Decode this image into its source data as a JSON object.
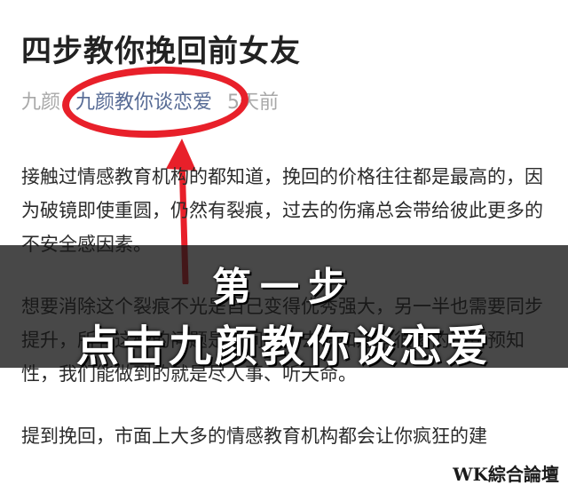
{
  "article": {
    "title": "四步教你挽回前女友",
    "meta": {
      "author": "九颜",
      "account": "九颜教你谈恋爱",
      "time": "5天前"
    },
    "paragraphs": [
      "接触过情感教育机构的都知道，挽回的价格往往都是最高的，因为破镜即使重圆，仍然有裂痕，过去的伤痛总会带给彼此更多的不安全感因素。",
      "想要消除这个裂痕不光是自己变得优秀强大，另一半也需要同步提升，所有这些的问题是时间的力去调和还有很多的不可预知性，我们能做到的就是尽人事、听天命。",
      "提到挽回，市面上大多的情感教育机构都会让你疯狂的建"
    ]
  },
  "overlay": {
    "step": "第一步",
    "instruction": "点击九颜教你谈恋爱"
  },
  "watermark": "WK綜合論壇",
  "colors": {
    "annotation": "#e8202a",
    "account_link": "#576b95",
    "overlay": "#141414"
  }
}
